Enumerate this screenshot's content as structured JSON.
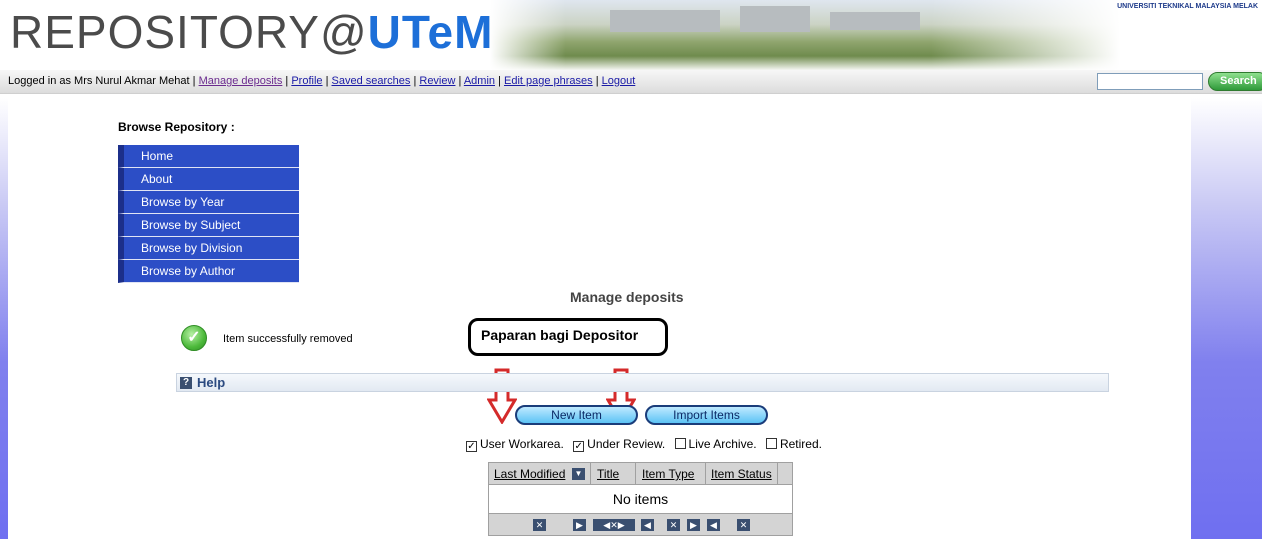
{
  "header": {
    "logo_prefix": "REPOSITORY@",
    "logo_brand": "UTeM",
    "university": "UNIVERSITI TEKNIKAL MALAYSIA MELAK"
  },
  "userbar": {
    "logged_in_text": "Logged in as Mrs Nurul Akmar Mehat | ",
    "links": [
      "Manage deposits",
      "Profile",
      "Saved searches",
      "Review",
      "Admin",
      "Edit page phrases",
      "Logout"
    ],
    "search_value": "",
    "search_button": "Search"
  },
  "browse": {
    "title": "Browse Repository :",
    "items": [
      "Home",
      "About",
      "Browse by Year",
      "Browse by Subject",
      "Browse by Division",
      "Browse by Author"
    ]
  },
  "page_title": "Manage deposits",
  "message": {
    "text": "Item successfully removed"
  },
  "annotation": {
    "text": "Paparan bagi Depositor",
    "color": "#d42a2a"
  },
  "help": {
    "label": "Help"
  },
  "actions": {
    "new_item": "New Item",
    "import_items": "Import Items"
  },
  "filters": [
    {
      "label": "User Workarea.",
      "checked": true
    },
    {
      "label": "Under Review.",
      "checked": true
    },
    {
      "label": "Live Archive.",
      "checked": false
    },
    {
      "label": "Retired.",
      "checked": false
    }
  ],
  "table": {
    "columns": [
      "Last Modified",
      "Title",
      "Item Type",
      "Item Status"
    ],
    "empty_text": "No items"
  }
}
